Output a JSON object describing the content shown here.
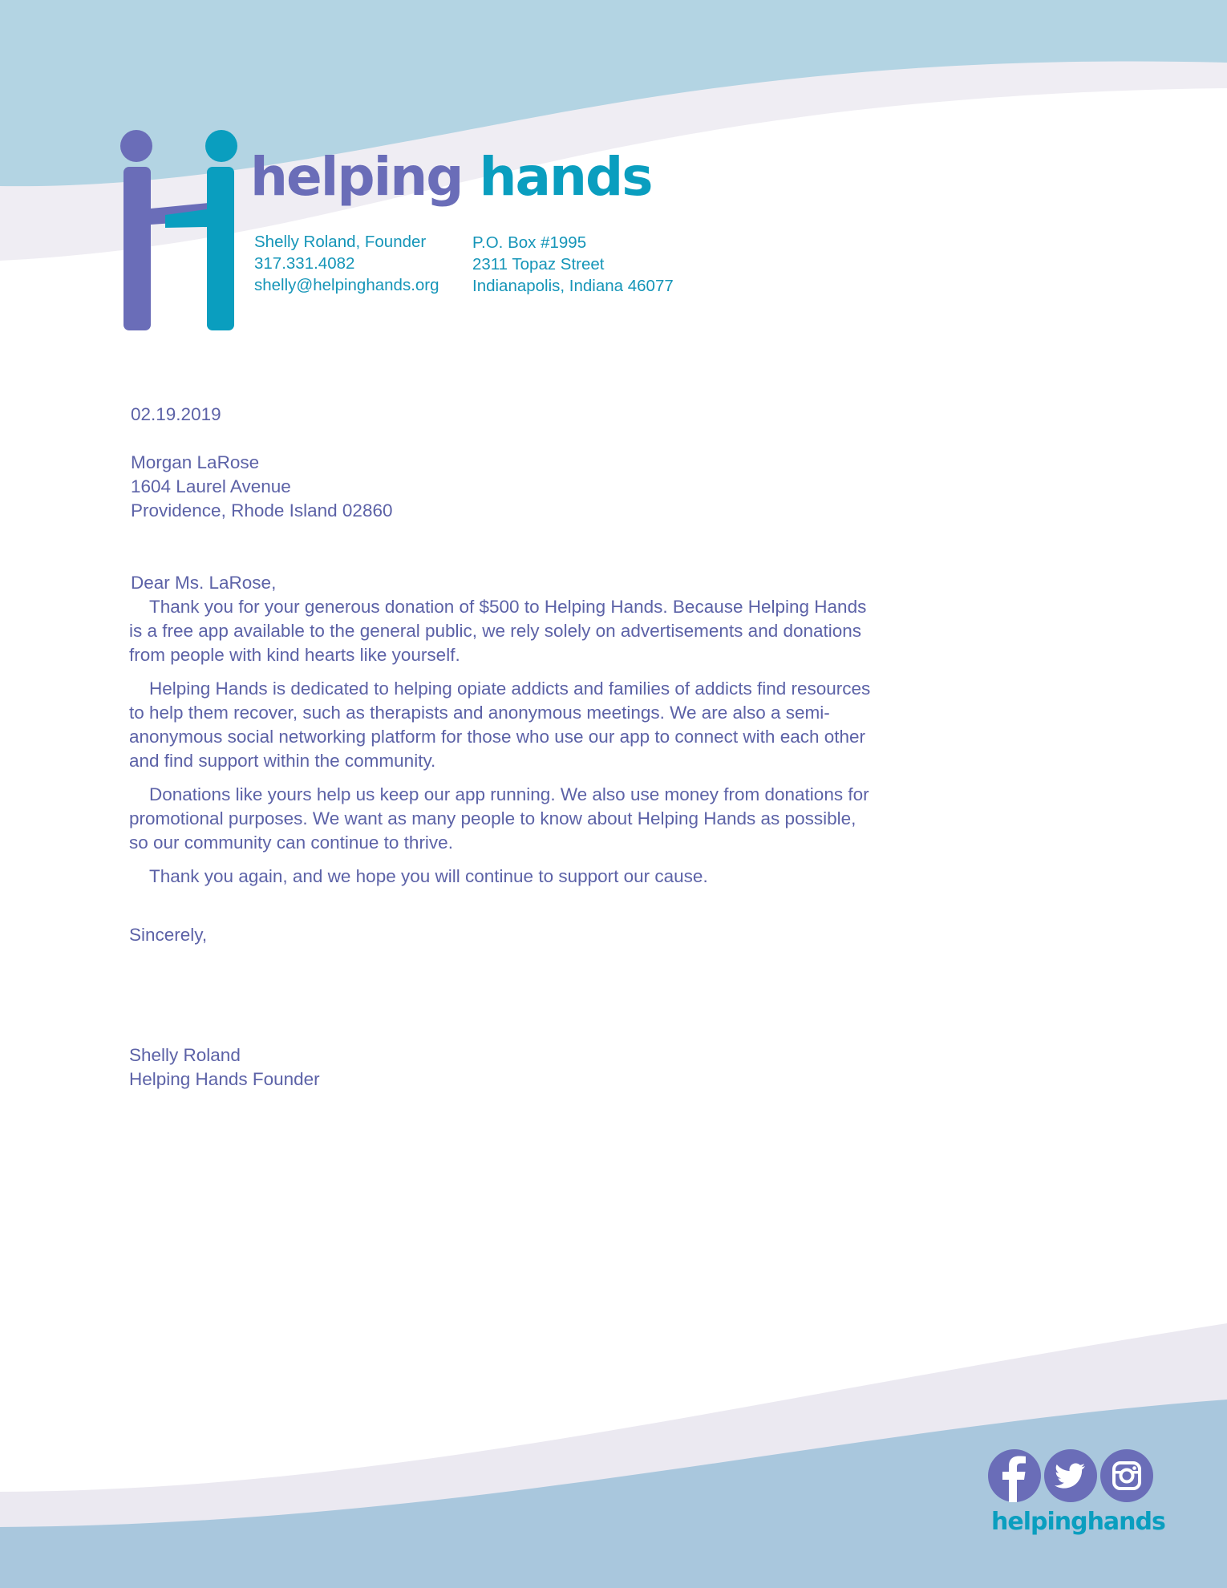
{
  "colors": {
    "purple": "#6a6db8",
    "teal": "#0a9ebf",
    "text": "#5c62a7",
    "header_wave": "#b3d4e3",
    "footer_wave": "#a9c7dd",
    "light_band": "#ebe9f1"
  },
  "brand": {
    "word1": "helping",
    "word2": "hands",
    "footer_wordmark": "helpinghands"
  },
  "contact": {
    "name": "Shelly Roland, Founder",
    "phone": "317.331.4082",
    "email": "shelly@helpinghands.org",
    "po_box": "P.O. Box #1995",
    "street": "2311 Topaz Street",
    "city": "Indianapolis, Indiana  46077"
  },
  "letter": {
    "date": "02.19.2019",
    "recipient": [
      "Morgan LaRose",
      "1604 Laurel Avenue",
      "Providence, Rhode Island  02860"
    ],
    "greeting": "Dear Ms. LaRose,",
    "paragraphs": [
      "Thank you for your generous donation of $500 to Helping Hands. Because Helping Hands is a free app available to the general public, we rely solely on advertisements and donations from people with kind hearts like yourself.",
      "Helping Hands is dedicated to helping opiate addicts and families of addicts find resources to help them recover, such as therapists and anonymous meetings. We are also a semi-anonymous social networking platform for those who use our app to connect with each other and find support within the community.",
      "Donations like yours help us keep our app running. We also use money from donations for promotional purposes. We want as many people to know about Helping Hands as possible, so our community can continue to thrive.",
      "Thank you again, and we hope you will continue to support our cause."
    ],
    "closing": "Sincerely,",
    "signer_name": "Shelly Roland",
    "signer_title": "Helping Hands Founder"
  },
  "social_icons": [
    "facebook-icon",
    "twitter-icon",
    "instagram-icon"
  ]
}
